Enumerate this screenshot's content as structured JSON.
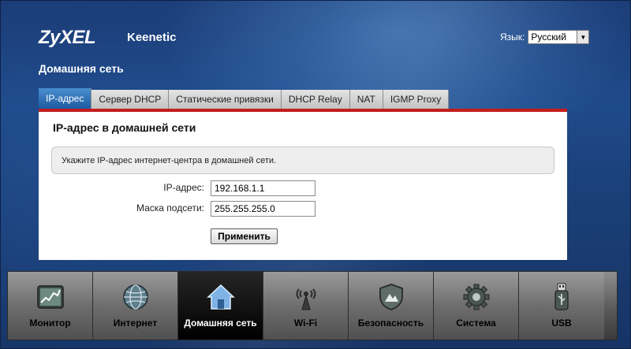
{
  "header": {
    "logo": "ZyXEL",
    "model": "Keenetic",
    "language_label": "Язык:",
    "language_value": "Русский"
  },
  "page_title": "Домашняя сеть",
  "tabs": [
    {
      "label": "IP-адрес",
      "active": true
    },
    {
      "label": "Сервер DHCP"
    },
    {
      "label": "Статические привязки"
    },
    {
      "label": "DHCP Relay"
    },
    {
      "label": "NAT"
    },
    {
      "label": "IGMP Proxy"
    }
  ],
  "panel": {
    "title": "IP-адрес в домашней сети",
    "hint": "Укажите IP-адрес интернет-центра в домашней сети.",
    "ip_label": "IP-адрес:",
    "ip_value": "192.168.1.1",
    "mask_label": "Маска подсети:",
    "mask_value": "255.255.255.0",
    "apply_label": "Применить"
  },
  "nav": [
    {
      "label": "Монитор",
      "icon": "monitor-icon"
    },
    {
      "label": "Интернет",
      "icon": "globe-icon"
    },
    {
      "label": "Домашняя сеть",
      "icon": "home-icon",
      "active": true
    },
    {
      "label": "Wi-Fi",
      "icon": "wifi-icon"
    },
    {
      "label": "Безопасность",
      "icon": "shield-icon"
    },
    {
      "label": "Система",
      "icon": "gear-icon"
    },
    {
      "label": "USB",
      "icon": "usb-icon"
    }
  ],
  "colors": {
    "background": "#1f4a8a",
    "tab_active": "#2a6bb3",
    "tab_underline": "#c41c1c"
  }
}
